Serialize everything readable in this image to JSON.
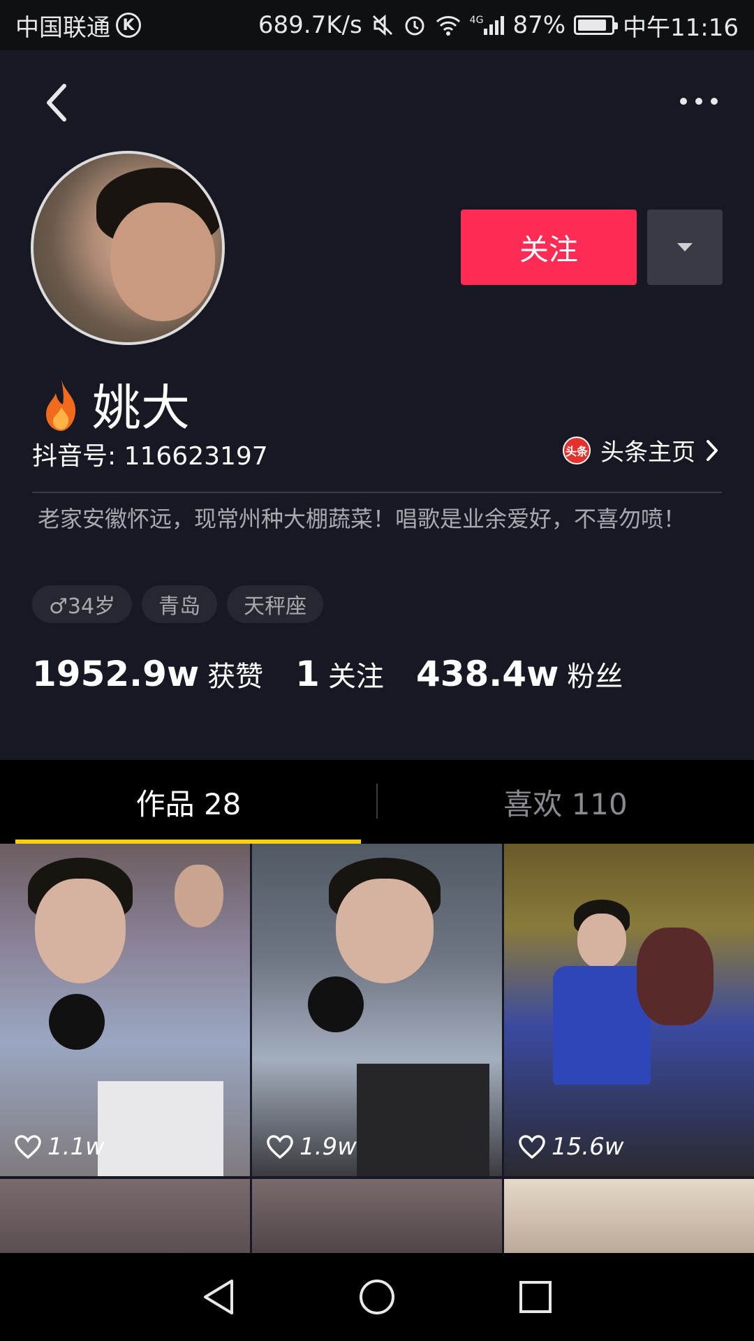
{
  "status_bar": {
    "carrier": "中国联通",
    "carrier_badge": "K",
    "network_speed": "689.7K/s",
    "signal_label": "4G",
    "battery": "87%",
    "battery_level": 0.87,
    "time": "中午11:16"
  },
  "header": {
    "back_icon": "chevron-left-icon",
    "more_icon": "more-horizontal-icon"
  },
  "profile": {
    "name": "姚大",
    "name_badge_icon": "fire-icon",
    "douyin_id": "抖音号: 116623197",
    "toutiao_badge": "头条",
    "toutiao_link": "头条主页",
    "follow_label": "关注",
    "bio": "老家安徽怀远，现常州种大棚蔬菜！唱歌是业余爱好，不喜勿喷！",
    "tags": [
      "♂34岁",
      "青岛",
      "天秤座"
    ],
    "stats": [
      {
        "num": "1952.9w",
        "label": "获赞"
      },
      {
        "num": "1",
        "label": "关注"
      },
      {
        "num": "438.4w",
        "label": "粉丝"
      }
    ]
  },
  "tabs": [
    {
      "label": "作品 28",
      "active": true
    },
    {
      "label": "喜欢 110",
      "active": false
    }
  ],
  "videos": [
    {
      "likes": "1.1w"
    },
    {
      "likes": "1.9w"
    },
    {
      "likes": "15.6w"
    },
    {
      "likes": ""
    },
    {
      "likes": ""
    },
    {
      "likes": ""
    }
  ],
  "colors": {
    "background": "#161823",
    "follow_button": "#fe2c55",
    "tab_indicator": "#face15"
  },
  "nav_bar": {
    "back": "triangle-back-icon",
    "home": "circle-home-icon",
    "recents": "square-recents-icon"
  }
}
